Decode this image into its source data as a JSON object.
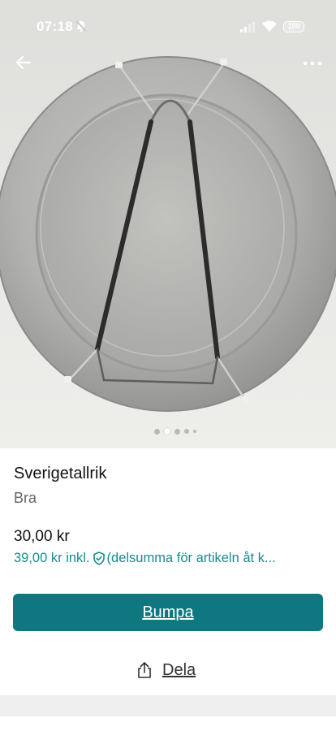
{
  "status_bar": {
    "time": "07:18",
    "battery": "100"
  },
  "header": {
    "back_icon": "arrow-left-icon",
    "more_icon": "more-horizontal-icon"
  },
  "gallery": {
    "image_count": 5,
    "active_index": 1
  },
  "listing": {
    "title": "Sverigetallrik",
    "condition": "Bra",
    "price": "30,00 kr",
    "price_incl_prefix": "39,00 kr inkl.",
    "price_incl_suffix": "(delsumma för artikeln åt k..."
  },
  "actions": {
    "bump_label": "Bumpa",
    "share_label": "Dela"
  },
  "colors": {
    "accent": "#0e7780",
    "link": "#1a8a91"
  }
}
